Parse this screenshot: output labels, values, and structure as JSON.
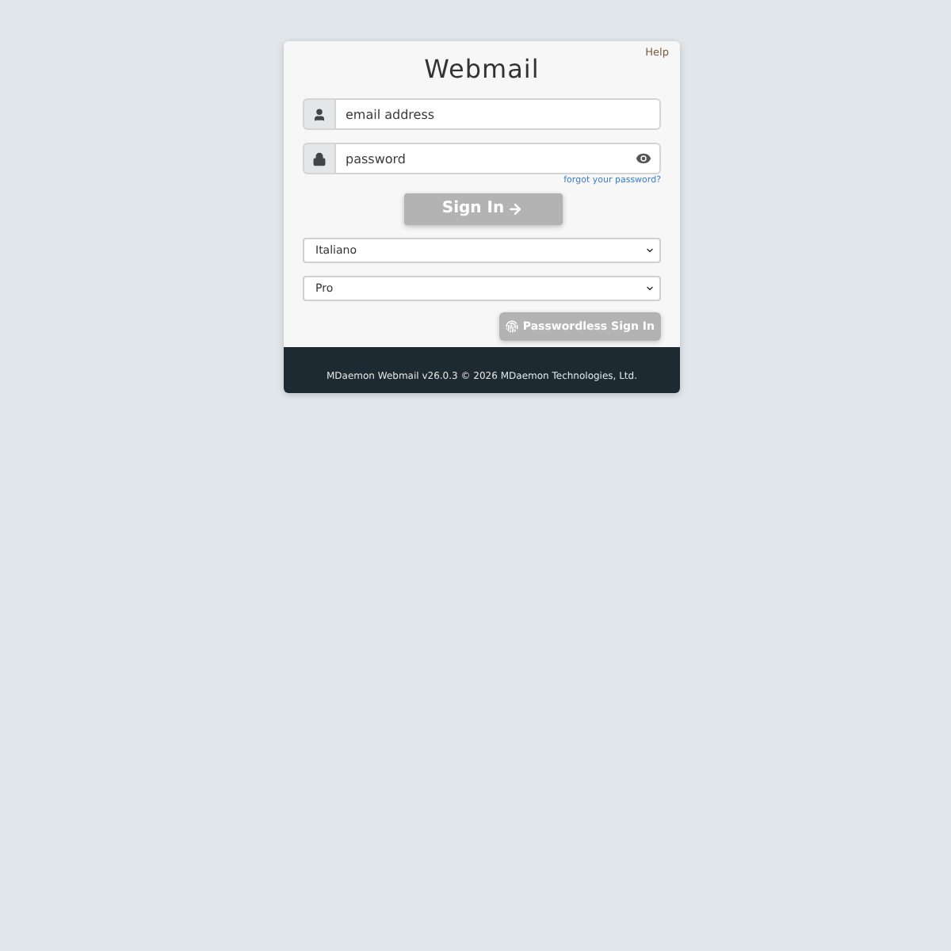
{
  "header": {
    "title": "Webmail",
    "help_link": "Help"
  },
  "fields": [
    {
      "kind": "email",
      "placeholder": "email address"
    },
    {
      "kind": "password",
      "placeholder": "password"
    }
  ],
  "forgot_link": "forgot your password?",
  "sign_in": {
    "label": "Sign In",
    "disabled": true
  },
  "selects": [
    {
      "value": "Italiano"
    },
    {
      "value": "Pro"
    }
  ],
  "passwordless": {
    "label": "Passwordless Sign In",
    "disabled": true
  },
  "footer": {
    "text": "MDaemon Webmail v26.0.3 © 2026",
    "link": "MDaemon Technologies, Ltd."
  }
}
